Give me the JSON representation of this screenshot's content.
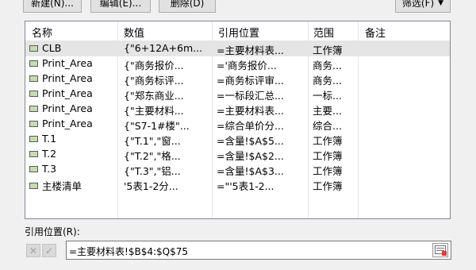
{
  "toolbar": {
    "new_label": "新建(N)...",
    "edit_label": "编辑(E)...",
    "delete_label": "删除(D)",
    "filter_label": "筛选(F)"
  },
  "columns": [
    "名称",
    "数值",
    "引用位置",
    "范围",
    "备注"
  ],
  "rows": [
    {
      "name": "CLB",
      "value": "{\"6+12A+6m...",
      "ref": "=主要材料表...",
      "scope": "工作簿",
      "icon": "named-range-icon",
      "selected": true
    },
    {
      "name": "Print_Area",
      "value": "{\"商务报价...",
      "ref": "='商务报价...",
      "scope": "商务...",
      "icon": "named-range-icon",
      "selected": false
    },
    {
      "name": "Print_Area",
      "value": "{\"商务标评...",
      "ref": "=商务标评审...",
      "scope": "商务...",
      "icon": "named-range-icon",
      "selected": false
    },
    {
      "name": "Print_Area",
      "value": "{\"郑东商业...",
      "ref": "=一标段汇总...",
      "scope": "一标...",
      "icon": "named-range-icon",
      "selected": false
    },
    {
      "name": "Print_Area",
      "value": "{\"主要材料...",
      "ref": "=主要材料表...",
      "scope": "主要...",
      "icon": "named-range-icon",
      "selected": false
    },
    {
      "name": "Print_Area",
      "value": "{\"S7-1#楼\"...",
      "ref": "=综合单价分...",
      "scope": "综合...",
      "icon": "named-range-icon",
      "selected": false
    },
    {
      "name": "T.1",
      "value": "{\"T.1\",\"窗...",
      "ref": "=含量!$A$5...",
      "scope": "工作簿",
      "icon": "named-range-icon",
      "selected": false
    },
    {
      "name": "T.2",
      "value": "{\"T.2\",\"格...",
      "ref": "=含量!$A$2...",
      "scope": "工作簿",
      "icon": "named-range-icon",
      "selected": false
    },
    {
      "name": "T.3",
      "value": "{\"T.3\",\"铝...",
      "ref": "=含量!$A$3...",
      "scope": "工作簿",
      "icon": "named-range-icon",
      "selected": false
    },
    {
      "name": "主楼清单",
      "value": "'5表1-2分...",
      "ref": "=\"'5表1-2...",
      "scope": "工作簿",
      "icon": "named-range-icon",
      "selected": false
    }
  ],
  "refers_to": {
    "label": "引用位置(R):",
    "value": "=主要材料表!$B$4:$Q$75",
    "cancel_icon": "cancel-x-icon",
    "confirm_icon": "confirm-check-icon",
    "collapse_icon": "collapse-dialog-icon"
  }
}
